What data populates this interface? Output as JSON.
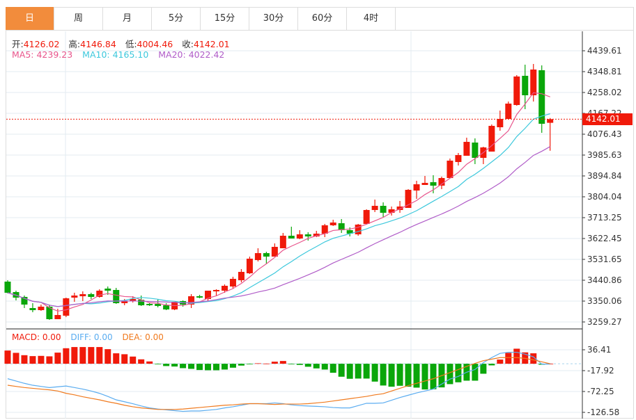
{
  "tabs": [
    {
      "label": "日",
      "active": true
    },
    {
      "label": "周",
      "active": false
    },
    {
      "label": "月",
      "active": false
    },
    {
      "label": "5分",
      "active": false
    },
    {
      "label": "15分",
      "active": false
    },
    {
      "label": "30分",
      "active": false
    },
    {
      "label": "60分",
      "active": false
    },
    {
      "label": "4时",
      "active": false
    }
  ],
  "ohlc_info": {
    "open_label": "开:",
    "open": "4126.02",
    "high_label": "高:",
    "high": "4146.84",
    "low_label": "低:",
    "low": "4004.46",
    "close_label": "收:",
    "close": "4142.01"
  },
  "ma_info": {
    "ma5": "MA5: 4239.23",
    "ma10": "MA10: 4165.10",
    "ma20": "MA20: 4022.42"
  },
  "macd_info": {
    "macd": "MACD: 0.00",
    "diff": "DIFF: 0.00",
    "dea": "DEA: 0.00"
  },
  "current_price_tag": "4142.01",
  "colors": {
    "accent_tab": "#f28c3c",
    "up": "#f01a0a",
    "down": "#0aa60a",
    "ma5": "#e8558c",
    "ma10": "#3cc8dc",
    "ma20": "#b05cc8",
    "diff": "#5aacf0",
    "dea": "#f07a1e"
  },
  "chart_data": [
    {
      "type": "candlestick",
      "y_ticks": [
        "4439.61",
        "4348.81",
        "4258.02",
        "4167.22",
        "4076.43",
        "3985.63",
        "3894.84",
        "3804.04",
        "3713.25",
        "3622.45",
        "3531.65",
        "3440.86",
        "3350.06",
        "3259.27"
      ],
      "ylim": [
        3259.27,
        4439.61
      ],
      "grid": true,
      "ohlc": [
        [
          3434.8,
          3440.9,
          3383.3,
          3386.4
        ],
        [
          3389.4,
          3395.4,
          3353.1,
          3365.2
        ],
        [
          3368.2,
          3374.3,
          3319.8,
          3334.9
        ],
        [
          3319.8,
          3341.0,
          3301.6,
          3310.7
        ],
        [
          3310.7,
          3334.9,
          3307.7,
          3325.8
        ],
        [
          3325.8,
          3334.9,
          3268.3,
          3271.4
        ],
        [
          3271.4,
          3316.7,
          3271.4,
          3289.5
        ],
        [
          3286.5,
          3365.2,
          3280.4,
          3362.2
        ],
        [
          3365.2,
          3386.4,
          3347.0,
          3374.3
        ],
        [
          3371.2,
          3392.4,
          3350.0,
          3380.3
        ],
        [
          3380.3,
          3386.4,
          3359.1,
          3368.2
        ],
        [
          3368.2,
          3401.5,
          3365.2,
          3395.4
        ],
        [
          3404.5,
          3413.6,
          3377.3,
          3395.4
        ],
        [
          3398.5,
          3407.6,
          3337.9,
          3341.0
        ],
        [
          3341.0,
          3359.1,
          3331.9,
          3350.0
        ],
        [
          3350.0,
          3371.2,
          3344.0,
          3359.1
        ],
        [
          3356.1,
          3374.3,
          3328.9,
          3331.9
        ],
        [
          3337.9,
          3344.0,
          3328.9,
          3331.9
        ],
        [
          3337.9,
          3356.1,
          3322.8,
          3328.9
        ],
        [
          3331.9,
          3341.0,
          3310.7,
          3313.7
        ],
        [
          3313.7,
          3347.0,
          3310.7,
          3347.0
        ],
        [
          3350.0,
          3353.1,
          3325.8,
          3334.9
        ],
        [
          3334.9,
          3380.3,
          3319.8,
          3371.2
        ],
        [
          3371.2,
          3377.3,
          3362.2,
          3365.2
        ],
        [
          3359.1,
          3395.4,
          3350.0,
          3395.4
        ],
        [
          3392.4,
          3401.5,
          3374.3,
          3398.5
        ],
        [
          3395.4,
          3422.7,
          3386.4,
          3416.7
        ],
        [
          3413.6,
          3456.0,
          3404.5,
          3446.9
        ],
        [
          3440.9,
          3489.3,
          3431.8,
          3477.2
        ],
        [
          3471.1,
          3543.7,
          3468.1,
          3534.7
        ],
        [
          3528.6,
          3580.0,
          3522.6,
          3558.9
        ],
        [
          3558.9,
          3564.9,
          3513.5,
          3543.7
        ],
        [
          3543.7,
          3601.2,
          3543.7,
          3586.1
        ],
        [
          3580.0,
          3646.6,
          3580.0,
          3634.5
        ],
        [
          3634.5,
          3673.9,
          3622.4,
          3622.4
        ],
        [
          3622.4,
          3658.7,
          3619.4,
          3640.6
        ],
        [
          3640.6,
          3649.7,
          3613.4,
          3631.5
        ],
        [
          3631.5,
          3655.7,
          3628.5,
          3643.6
        ],
        [
          3643.6,
          3686.0,
          3628.5,
          3679.9
        ],
        [
          3679.9,
          3704.2,
          3676.9,
          3692.0
        ],
        [
          3689.0,
          3707.2,
          3646.6,
          3658.7
        ],
        [
          3658.7,
          3670.9,
          3631.5,
          3643.6
        ],
        [
          3640.6,
          3686.0,
          3634.5,
          3683.0
        ],
        [
          3686.0,
          3749.6,
          3683.0,
          3746.5
        ],
        [
          3746.5,
          3791.9,
          3737.5,
          3764.7
        ],
        [
          3764.7,
          3779.8,
          3716.3,
          3734.4
        ],
        [
          3734.4,
          3761.7,
          3722.3,
          3749.6
        ],
        [
          3746.5,
          3785.9,
          3734.4,
          3761.7
        ],
        [
          3755.6,
          3837.3,
          3755.6,
          3834.3
        ],
        [
          3831.3,
          3873.7,
          3795.0,
          3858.5
        ],
        [
          3855.5,
          3894.8,
          3855.5,
          3864.6
        ],
        [
          3867.6,
          3897.9,
          3819.2,
          3852.5
        ],
        [
          3852.5,
          3891.8,
          3837.3,
          3885.7
        ],
        [
          3885.7,
          3970.5,
          3885.7,
          3961.4
        ],
        [
          3955.4,
          3994.7,
          3940.2,
          3985.6
        ],
        [
          3982.6,
          4061.3,
          3982.6,
          4043.1
        ],
        [
          4040.1,
          4058.3,
          3946.3,
          3973.5
        ],
        [
          3973.5,
          4021.9,
          3946.3,
          4018.9
        ],
        [
          4000.8,
          4118.8,
          4000.8,
          4112.7
        ],
        [
          4106.7,
          4179.3,
          4091.5,
          4143.0
        ],
        [
          4143.0,
          4218.7,
          4143.0,
          4209.6
        ],
        [
          4203.5,
          4333.7,
          4200.5,
          4327.6
        ],
        [
          4330.6,
          4379.1,
          4185.4,
          4245.9
        ],
        [
          4245.9,
          4382.1,
          4218.7,
          4357.9
        ],
        [
          4354.9,
          4376.0,
          4082.4,
          4121.8
        ],
        [
          4126.02,
          4146.84,
          4004.46,
          4142.01
        ]
      ],
      "moving_averages": [
        5,
        10,
        20
      ],
      "last_price": 4142.01
    },
    {
      "type": "bar+line",
      "y_ticks": [
        "36.41",
        "-17.92",
        "-72.25",
        "-126.58"
      ],
      "ylim": [
        -126.58,
        36.41
      ],
      "macd_hist": [
        34.4,
        28.4,
        22.3,
        19.9,
        20.5,
        19.3,
        29.0,
        40.4,
        43.5,
        43.5,
        43.5,
        43.5,
        38.0,
        27.2,
        24.8,
        18.7,
        11.5,
        6.0,
        -0.5,
        -6.0,
        -7.2,
        -11.5,
        -13.3,
        -16.3,
        -16.9,
        -16.9,
        -15.1,
        -10.3,
        -4.8,
        -0.5,
        1.2,
        0.5,
        5.4,
        7.2,
        -0.6,
        -3.0,
        -7.8,
        -12.1,
        -15.1,
        -23.5,
        -33.8,
        -39.2,
        -38.6,
        -38.6,
        -46.5,
        -56.7,
        -59.8,
        -57.4,
        -59.8,
        -62.2,
        -67.0,
        -66.4,
        -61.6,
        -53.1,
        -48.3,
        -44.1,
        -44.1,
        -26.0,
        -4.2,
        10.9,
        28.4,
        39.2,
        29.6,
        27.2,
        -2.4,
        0.3
      ],
      "diff": [
        -39,
        -45,
        -51,
        -56,
        -59,
        -62,
        -60,
        -58,
        -62,
        -66,
        -71,
        -77,
        -85,
        -94,
        -99,
        -104,
        -110,
        -115,
        -118,
        -120,
        -122,
        -124,
        -123,
        -123,
        -121,
        -119,
        -115,
        -112,
        -108,
        -104,
        -104,
        -104,
        -102,
        -104,
        -107,
        -109,
        -110,
        -111,
        -112,
        -114,
        -115,
        -115,
        -109,
        -103,
        -103,
        -102,
        -95,
        -88,
        -82,
        -76,
        -71,
        -66,
        -53,
        -40,
        -33,
        -22,
        -15,
        3,
        16,
        27,
        30,
        30,
        25,
        18,
        -1,
        -1
      ],
      "dea": [
        -56,
        -59,
        -62,
        -64,
        -66,
        -68,
        -71,
        -77,
        -81,
        -86,
        -90,
        -94,
        -99,
        -103,
        -108,
        -112,
        -115,
        -117,
        -119,
        -119,
        -119,
        -118,
        -116,
        -114,
        -112,
        -110,
        -108,
        -107,
        -105,
        -104,
        -104,
        -105,
        -106,
        -105,
        -105,
        -105,
        -104,
        -102,
        -100,
        -97,
        -94,
        -91,
        -88,
        -85,
        -81,
        -78,
        -71,
        -64,
        -57,
        -51,
        -45,
        -39,
        -31,
        -23,
        -15,
        -7,
        1,
        8,
        12,
        16,
        16,
        16,
        14,
        10,
        5,
        0
      ]
    }
  ]
}
